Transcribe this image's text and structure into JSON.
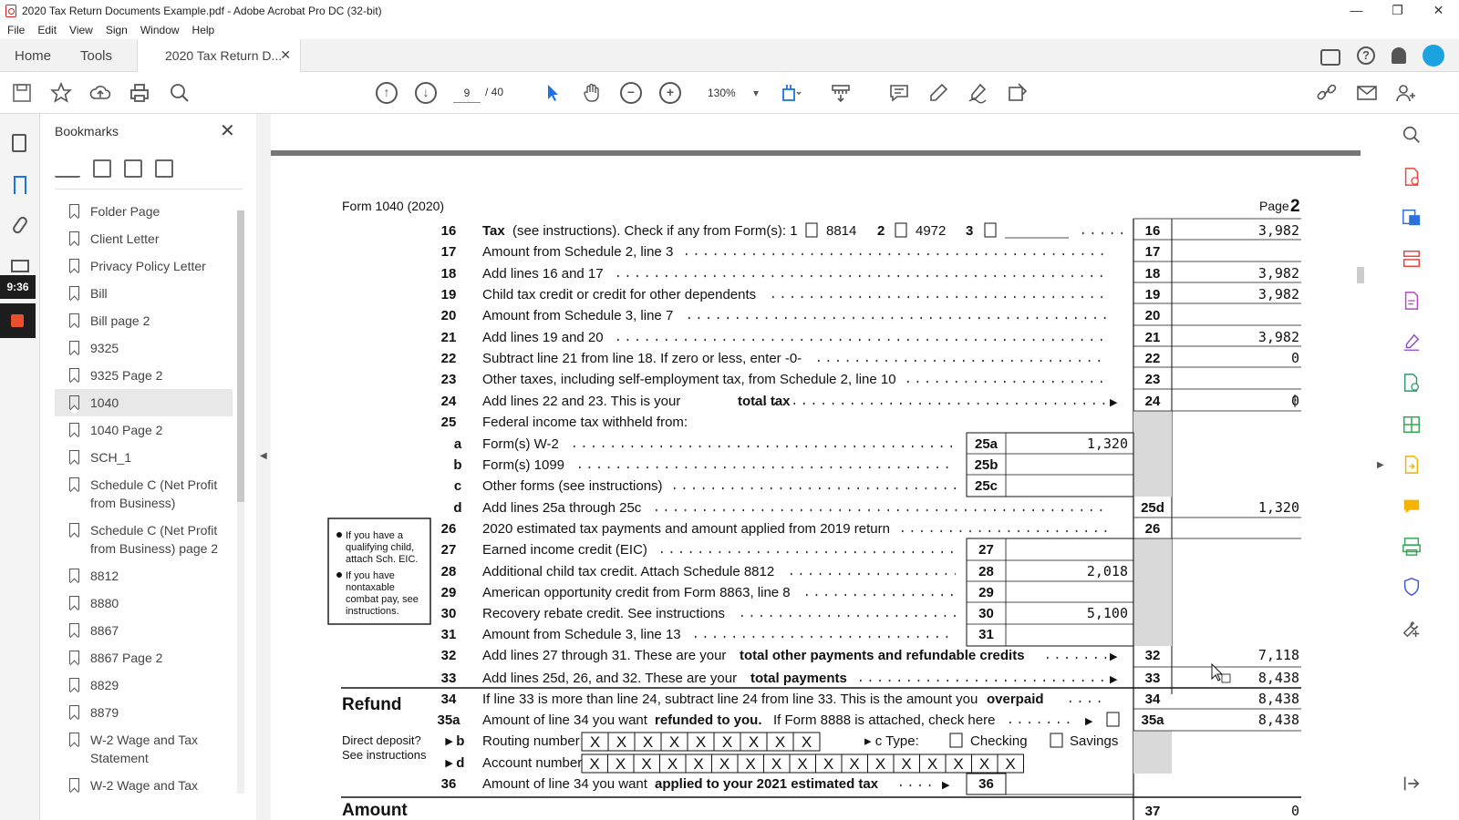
{
  "window": {
    "title": "2020 Tax Return Documents Example.pdf - Adobe Acrobat Pro DC (32-bit)",
    "controls": {
      "minimize": "—",
      "restore": "❐",
      "close": "✕"
    }
  },
  "menu": [
    "File",
    "Edit",
    "View",
    "Sign",
    "Window",
    "Help"
  ],
  "tabs": {
    "home": "Home",
    "tools": "Tools",
    "document": "2020 Tax Return D...",
    "close": "✕"
  },
  "toolbar": {
    "page_current": "9",
    "page_total": "/ 40",
    "zoom": "130%"
  },
  "leftrail": {
    "time": "9:36"
  },
  "bookmarks": {
    "title": "Bookmarks",
    "close": "✕",
    "items": [
      "Folder Page",
      "Client Letter",
      "Privacy Policy Letter",
      "Bill",
      "Bill page 2",
      "9325",
      "9325 Page 2",
      "1040",
      "1040 Page 2",
      "SCH_1",
      "Schedule C (Net Profit from Business)",
      "Schedule C (Net Profit from Business) page 2",
      "8812",
      "8880",
      "8867",
      "8867 Page 2",
      "8829",
      "8879",
      "W-2 Wage and Tax Statement",
      "W-2 Wage and Tax"
    ],
    "selected_index": 7
  },
  "form": {
    "header_left": "Form 1040 (2020)",
    "header_page_label": "Page",
    "header_page_num": "2",
    "line16": {
      "num": "16",
      "text": "(see instructions). Check if any from Form(s): 1",
      "bold": "Tax",
      "opt1": "8814",
      "n2": "2",
      "opt2": "4972",
      "n3": "3",
      "box": "16",
      "amount": "3,982"
    },
    "line17": {
      "num": "17",
      "text": "Amount from Schedule 2, line 3",
      "box": "17",
      "amount": ""
    },
    "line18": {
      "num": "18",
      "text": "Add lines 16 and 17",
      "box": "18",
      "amount": "3,982"
    },
    "line19": {
      "num": "19",
      "text": "Child tax credit or credit for other dependents",
      "box": "19",
      "amount": "3,982"
    },
    "line20": {
      "num": "20",
      "text": "Amount from Schedule 3, line 7",
      "box": "20",
      "amount": ""
    },
    "line21": {
      "num": "21",
      "text": "Add lines 19 and 20",
      "box": "21",
      "amount": "3,982"
    },
    "line22": {
      "num": "22",
      "text": "Subtract line 21 from line 18. If zero or less, enter -0-",
      "box": "22",
      "amount": "0"
    },
    "line23": {
      "num": "23",
      "text": "Other taxes, including self-employment tax, from Schedule 2, line 10",
      "box": "23",
      "amount": ""
    },
    "line24": {
      "num": "24",
      "text": "Add lines 22 and 23. This is your",
      "bold": "total tax",
      "box": "24",
      "amount": "0"
    },
    "line25": {
      "num": "25",
      "text": "Federal income tax withheld from:"
    },
    "line25a": {
      "num": "a",
      "text": "Form(s) W-2",
      "box": "25a",
      "amount": "1,320"
    },
    "line25b": {
      "num": "b",
      "text": "Form(s) 1099",
      "box": "25b",
      "amount": ""
    },
    "line25c": {
      "num": "c",
      "text": "Other forms (see instructions)",
      "box": "25c",
      "amount": ""
    },
    "line25d": {
      "num": "d",
      "text": "Add lines 25a through 25c",
      "box": "25d",
      "amount": "1,320"
    },
    "line26": {
      "num": "26",
      "text": "2020 estimated tax payments and amount applied from 2019 return",
      "box": "26",
      "amount": ""
    },
    "line27": {
      "num": "27",
      "text": "Earned income credit (EIC)",
      "box": "27",
      "amount": ""
    },
    "line28": {
      "num": "28",
      "text": "Additional child tax credit. Attach Schedule 8812",
      "box": "28",
      "amount": "2,018"
    },
    "line29": {
      "num": "29",
      "text": "American opportunity credit from Form 8863, line 8",
      "box": "29",
      "amount": ""
    },
    "line30": {
      "num": "30",
      "text": "Recovery rebate credit. See instructions",
      "box": "30",
      "amount": "5,100"
    },
    "line31": {
      "num": "31",
      "text": "Amount from Schedule 3, line 13",
      "box": "31",
      "amount": ""
    },
    "line32": {
      "num": "32",
      "text": "Add lines 27 through 31. These are your",
      "bold": "total other payments and refundable credits",
      "box": "32",
      "amount": "7,118"
    },
    "line33": {
      "num": "33",
      "text": "Add lines 25d, 26, and 32. These are your",
      "bold": "total payments",
      "box": "33",
      "amount": "8,438"
    },
    "line34": {
      "num": "34",
      "text": "If line 33 is more than line 24, subtract line 24 from line 33. This is the amount you",
      "bold": "overpaid",
      "box": "34",
      "amount": "8,438"
    },
    "line35a": {
      "num": "35a",
      "text": "Amount of line 34 you want",
      "bold": "refunded to you.",
      "text2": "If Form 8888 is attached, check here",
      "box": "35a",
      "amount": "8,438"
    },
    "line35b": {
      "num": "▸ b",
      "label": "Routing number",
      "routing": "XXXXXXXXX",
      "type_label": "▸ c Type:",
      "checking": "Checking",
      "savings": "Savings"
    },
    "line35d": {
      "num": "▸ d",
      "label": "Account number",
      "account": "XXXXXXXXXXXXXXXXX"
    },
    "line36": {
      "num": "36",
      "text": "Amount of line 34 you want",
      "bold": "applied to your 2021 estimated tax",
      "box": "36"
    },
    "line37": {
      "box": "37",
      "amount": "0"
    },
    "refund_label": "Refund",
    "amount_label": "Amount",
    "direct_deposit": "Direct deposit?",
    "see_instructions": "See instructions",
    "sidebox": {
      "b1": "If you have a qualifying child, attach Sch. EIC.",
      "b2": "If you have nontaxable combat pay, see instructions."
    }
  }
}
